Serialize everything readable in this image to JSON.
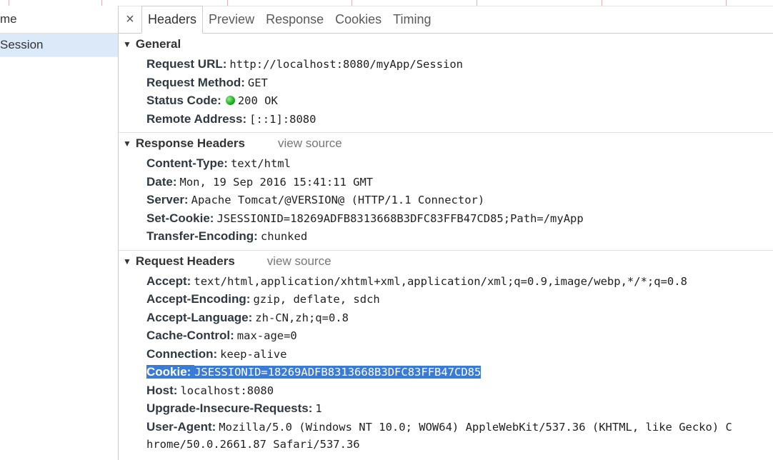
{
  "request_list": {
    "column_header": "me",
    "selected_row": "Session"
  },
  "tabs": [
    {
      "label": "Headers"
    },
    {
      "label": "Preview"
    },
    {
      "label": "Response"
    },
    {
      "label": "Cookies"
    },
    {
      "label": "Timing"
    }
  ],
  "close_glyph": "×",
  "general": {
    "title": "General",
    "request_url": {
      "name": "Request URL:",
      "value": "http://localhost:8080/myApp/Session"
    },
    "request_method": {
      "name": "Request Method:",
      "value": "GET"
    },
    "status_code": {
      "name": "Status Code:",
      "value": "200 OK",
      "status_color": "#1fa81f"
    },
    "remote_address": {
      "name": "Remote Address:",
      "value": "[::1]:8080"
    }
  },
  "response_headers": {
    "title": "Response Headers",
    "view_source": "view source",
    "content_type": {
      "name": "Content-Type:",
      "value": "text/html"
    },
    "date": {
      "name": "Date:",
      "value": "Mon, 19 Sep 2016 15:41:11 GMT"
    },
    "server": {
      "name": "Server:",
      "value": "Apache Tomcat/@VERSION@ (HTTP/1.1 Connector)"
    },
    "set_cookie": {
      "name": "Set-Cookie:",
      "value": "JSESSIONID=18269ADFB8313668B3DFC83FFB47CD85;Path=/myApp"
    },
    "transfer_encoding": {
      "name": "Transfer-Encoding:",
      "value": "chunked"
    }
  },
  "request_headers": {
    "title": "Request Headers",
    "view_source": "view source",
    "accept": {
      "name": "Accept:",
      "value": "text/html,application/xhtml+xml,application/xml;q=0.9,image/webp,*/*;q=0.8"
    },
    "accept_encoding": {
      "name": "Accept-Encoding:",
      "value": "gzip, deflate, sdch"
    },
    "accept_language": {
      "name": "Accept-Language:",
      "value": "zh-CN,zh;q=0.8"
    },
    "cache_control": {
      "name": "Cache-Control:",
      "value": "max-age=0"
    },
    "connection": {
      "name": "Connection:",
      "value": "keep-alive"
    },
    "cookie": {
      "name": "Cookie:",
      "value": "JSESSIONID=18269ADFB8313668B3DFC83FFB47CD85",
      "highlight_color": "#3a7bd5"
    },
    "host": {
      "name": "Host:",
      "value": "localhost:8080"
    },
    "upgrade_insecure_requests": {
      "name": "Upgrade-Insecure-Requests:",
      "value": "1"
    },
    "user_agent": {
      "name": "User-Agent:",
      "value_line1": "Mozilla/5.0 (Windows NT 10.0; WOW64) AppleWebKit/537.36 (KHTML, like Gecko) C",
      "value_line2": "hrome/50.0.2661.87 Safari/537.36"
    }
  }
}
